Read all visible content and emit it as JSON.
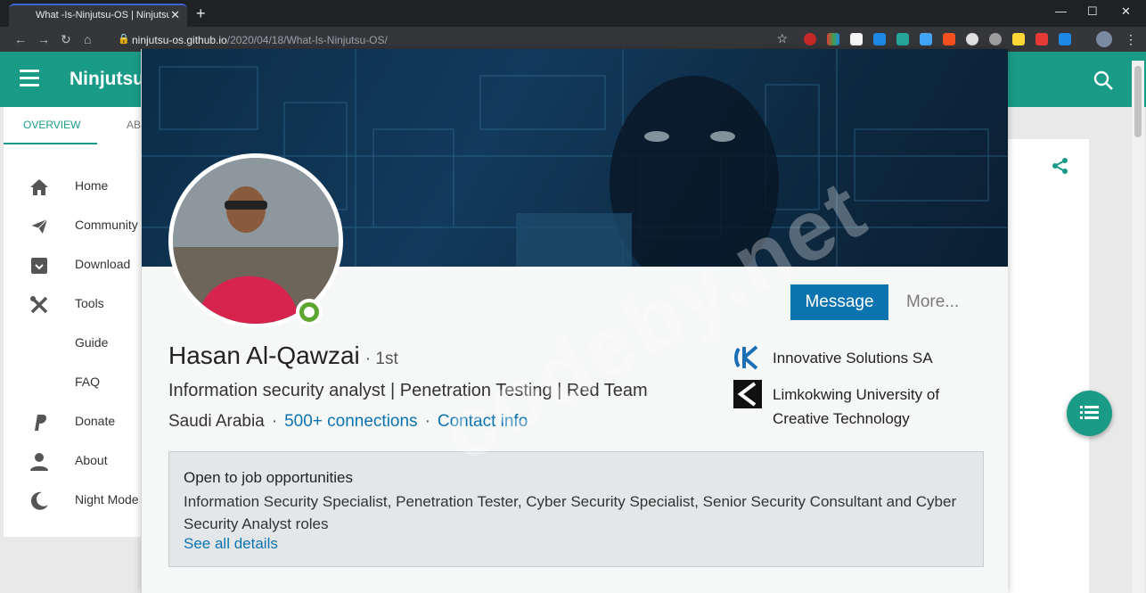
{
  "browser": {
    "tab_title": "What -Is-Ninjutsu-OS | Ninjutsu",
    "tab_close": "✕",
    "new_tab": "+",
    "url_host": "ninjutsu-os.github.io",
    "url_path": "/2020/04/18/What-Is-Ninjutsu-OS/",
    "window_controls": [
      "—",
      "☐",
      "✕"
    ]
  },
  "site": {
    "brand": "Ninjutsu",
    "accent_color": "#1a9b88",
    "tabs": [
      "OVERVIEW",
      "AB"
    ],
    "nav": [
      {
        "label": "Home",
        "icon": "home-icon"
      },
      {
        "label": "Community",
        "icon": "paper-plane-icon"
      },
      {
        "label": "Download",
        "icon": "archive-icon"
      },
      {
        "label": "Tools",
        "icon": "tools-icon"
      },
      {
        "label": "Guide",
        "icon": ""
      },
      {
        "label": "FAQ",
        "icon": ""
      },
      {
        "label": "Donate",
        "icon": "paypal-icon"
      },
      {
        "label": "About",
        "icon": "person-icon"
      },
      {
        "label": "Night Mode",
        "icon": "moon-icon"
      }
    ]
  },
  "profile": {
    "name": "Hasan Al-Qawzai",
    "degree": "· 1st",
    "headline": "Information security analyst | Penetration Testing | Red Team",
    "location": "Saudi Arabia",
    "connections": "500+ connections",
    "contact": "Contact info",
    "separator": "·",
    "message_button": "Message",
    "more_button": "More...",
    "orgs": [
      {
        "name": "Innovative Solutions SA",
        "icon": "innovative-solutions-logo"
      },
      {
        "name": "Limkokwing University of Creative Technology",
        "icon": "limkokwing-logo"
      }
    ],
    "open_to_work": {
      "title": "Open to job opportunities",
      "description": "Information Security Specialist, Penetration Tester, Cyber Security Specialist, Senior Security Consultant and Cyber Security Analyst roles",
      "link": "See all details"
    }
  },
  "watermark": "codeby.net"
}
